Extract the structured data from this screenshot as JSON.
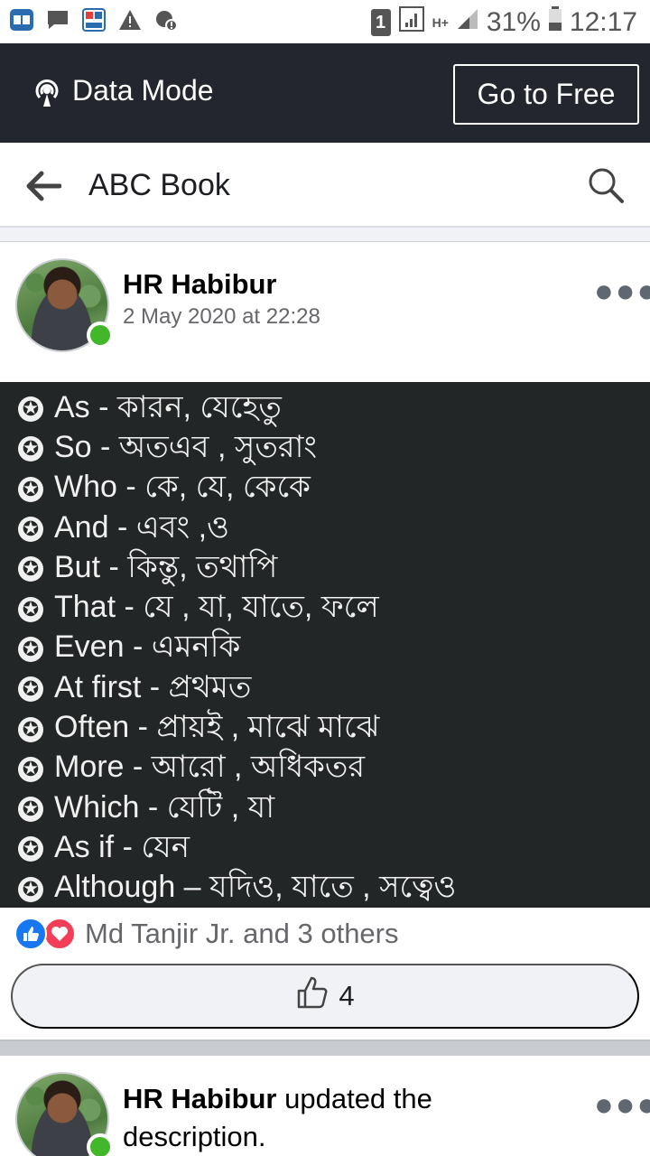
{
  "status_bar": {
    "battery_percent": "31%",
    "time": "12:17",
    "network": "H+",
    "sim_slot": "1"
  },
  "data_bar": {
    "label": "Data Mode",
    "go_free_label": "Go to Free"
  },
  "header": {
    "title": "ABC Book"
  },
  "post": {
    "author": "HR Habibur",
    "timestamp": "2 May 2020 at 22:28",
    "image_lines": [
      "As - কারন, যেহেতু",
      "So - অতএব , সুতরাং",
      "Who - কে, যে, কেকে",
      "And - এবং ,ও",
      "But - কিন্তু, তথাপি",
      "That - যে , যা, যাতে, ফলে",
      "Even - এমনকি",
      "At first - প্রথমত",
      "Often - প্রায়ই , মাঝে মাঝে",
      "More - আরো , অধিকতর",
      "Which - যেটি , যা",
      "As if - যেন",
      "Although – যদিও, যাতে , সত্বেও"
    ],
    "reactions_text": "Md Tanjir Jr. and 3 others",
    "like_count": "4"
  },
  "post2": {
    "author": "HR Habibur",
    "action": " updated the description."
  },
  "colors": {
    "data_bar_bg": "#23262f",
    "online": "#42b72a",
    "like_blue": "#1877f2",
    "love_red": "#f33e58"
  }
}
